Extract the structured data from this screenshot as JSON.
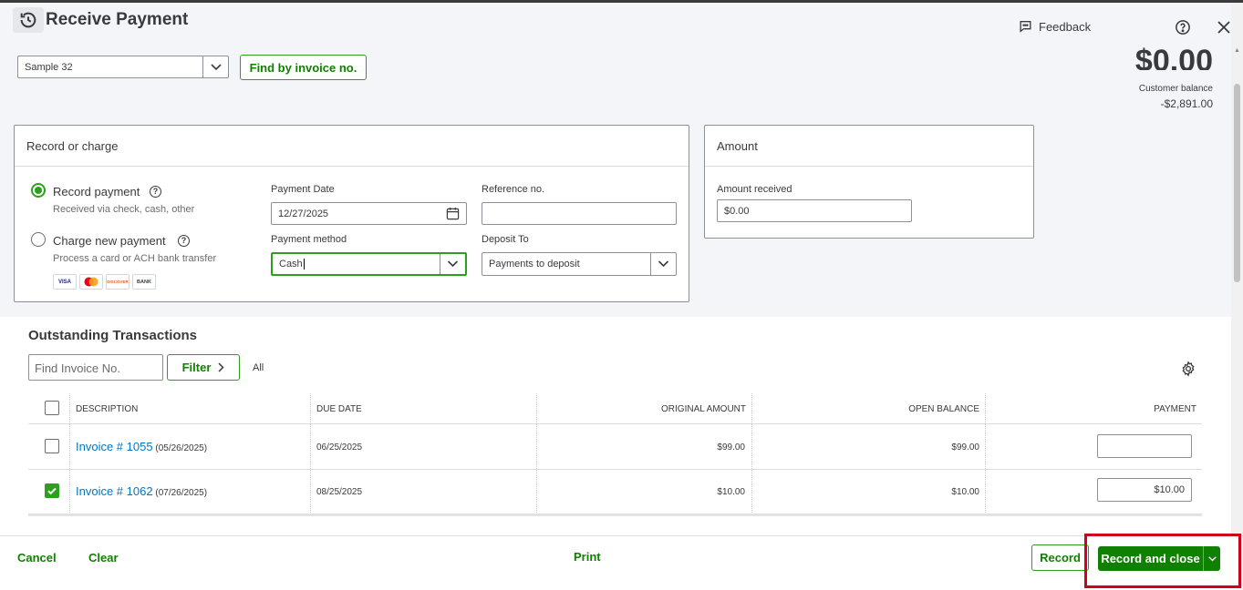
{
  "page": {
    "title": "Receive Payment",
    "feedback_label": "Feedback",
    "accent_color": "#2ca01c",
    "link_color": "#0077c5",
    "highlight_color": "#d0021b"
  },
  "customer": {
    "selected": "Sample 32",
    "find_by_invoice_label": "Find by invoice no."
  },
  "summary": {
    "amount": "$0.00",
    "customer_balance_label": "Customer balance",
    "customer_balance_value": "-$2,891.00"
  },
  "record_panel": {
    "title": "Record or charge",
    "record_payment_label": "Record payment",
    "record_payment_sub": "Received via check, cash, other",
    "charge_label": "Charge new payment",
    "charge_sub": "Process a card or ACH bank transfer",
    "cards": [
      "VISA",
      "MC",
      "DISCOVER",
      "BANK"
    ],
    "payment_date_label": "Payment Date",
    "payment_date_value": "12/27/2025",
    "reference_label": "Reference no.",
    "reference_value": "",
    "payment_method_label": "Payment method",
    "payment_method_value": "Cash",
    "deposit_to_label": "Deposit To",
    "deposit_to_value": "Payments to deposit"
  },
  "amount_panel": {
    "title": "Amount",
    "amount_received_label": "Amount received",
    "amount_received_value": "$0.00"
  },
  "transactions": {
    "title": "Outstanding Transactions",
    "find_placeholder": "Find Invoice No.",
    "filter_label": "Filter",
    "all_label": "All",
    "columns": [
      "DESCRIPTION",
      "DUE DATE",
      "ORIGINAL AMOUNT",
      "OPEN BALANCE",
      "PAYMENT"
    ],
    "rows": [
      {
        "invoice": "Invoice # 1055",
        "inv_date": "(05/26/2025)",
        "due": "06/25/2025",
        "original": "$99.00",
        "open": "$99.00",
        "payment": "",
        "checked": false
      },
      {
        "invoice": "Invoice # 1062",
        "inv_date": "(07/26/2025)",
        "due": "08/25/2025",
        "original": "$10.00",
        "open": "$10.00",
        "payment": "$10.00",
        "checked": true
      }
    ]
  },
  "footer": {
    "cancel_label": "Cancel",
    "clear_label": "Clear",
    "print_label": "Print",
    "record_label": "Record",
    "record_close_label": "Record and close"
  }
}
